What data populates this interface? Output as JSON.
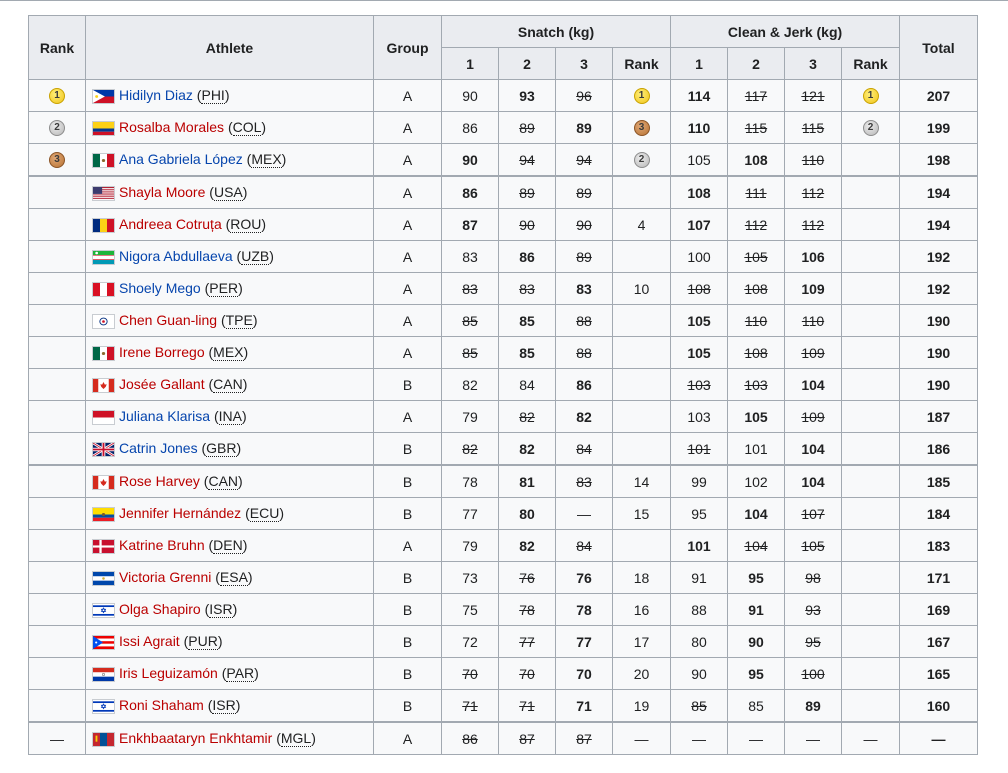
{
  "headers": {
    "rank": "Rank",
    "athlete": "Athlete",
    "group": "Group",
    "snatch": "Snatch (kg)",
    "clean_jerk": "Clean & Jerk (kg)",
    "total": "Total",
    "sub": [
      "1",
      "2",
      "3",
      "Rank",
      "1",
      "2",
      "3",
      "Rank"
    ]
  },
  "rows": [
    {
      "rank": "1",
      "rank_type": "gold",
      "name": "Hidilyn Diaz",
      "code": "PHI",
      "flag": "PHI",
      "link": "blue",
      "group": "A",
      "sn": [
        {
          "v": "90",
          "s": "n"
        },
        {
          "v": "93",
          "s": "b"
        },
        {
          "v": "96",
          "s": "x"
        }
      ],
      "sn_rank": "1",
      "sn_rank_type": "gold",
      "cj": [
        {
          "v": "114",
          "s": "b"
        },
        {
          "v": "117",
          "s": "x"
        },
        {
          "v": "121",
          "s": "x"
        }
      ],
      "cj_rank": "1",
      "cj_rank_type": "gold",
      "total": "207"
    },
    {
      "rank": "2",
      "rank_type": "silver",
      "name": "Rosalba Morales",
      "code": "COL",
      "flag": "COL",
      "link": "red",
      "group": "A",
      "sn": [
        {
          "v": "86",
          "s": "n"
        },
        {
          "v": "89",
          "s": "x"
        },
        {
          "v": "89",
          "s": "b"
        }
      ],
      "sn_rank": "3",
      "sn_rank_type": "bronze",
      "cj": [
        {
          "v": "110",
          "s": "b"
        },
        {
          "v": "115",
          "s": "x"
        },
        {
          "v": "115",
          "s": "x"
        }
      ],
      "cj_rank": "2",
      "cj_rank_type": "silver",
      "total": "199"
    },
    {
      "rank": "3",
      "rank_type": "bronze",
      "name": "Ana Gabriela López",
      "code": "MEX",
      "flag": "MEX",
      "link": "blue",
      "group": "A",
      "sn": [
        {
          "v": "90",
          "s": "b"
        },
        {
          "v": "94",
          "s": "x"
        },
        {
          "v": "94",
          "s": "x"
        }
      ],
      "sn_rank": "2",
      "sn_rank_type": "silver",
      "cj": [
        {
          "v": "105",
          "s": "n"
        },
        {
          "v": "108",
          "s": "b"
        },
        {
          "v": "110",
          "s": "x"
        }
      ],
      "cj_rank": "",
      "cj_rank_type": "none",
      "total": "198"
    },
    {
      "rank": "",
      "rank_type": "none",
      "name": "Shayla Moore",
      "code": "USA",
      "flag": "USA",
      "link": "red",
      "group": "A",
      "sep": true,
      "sn": [
        {
          "v": "86",
          "s": "b"
        },
        {
          "v": "89",
          "s": "x"
        },
        {
          "v": "89",
          "s": "x"
        }
      ],
      "sn_rank": "",
      "sn_rank_type": "none",
      "cj": [
        {
          "v": "108",
          "s": "b"
        },
        {
          "v": "111",
          "s": "x"
        },
        {
          "v": "112",
          "s": "x"
        }
      ],
      "cj_rank": "",
      "cj_rank_type": "none",
      "total": "194"
    },
    {
      "rank": "",
      "rank_type": "none",
      "name": "Andreea Cotruța",
      "code": "ROU",
      "flag": "ROU",
      "link": "red",
      "group": "A",
      "sn": [
        {
          "v": "87",
          "s": "b"
        },
        {
          "v": "90",
          "s": "x"
        },
        {
          "v": "90",
          "s": "x"
        }
      ],
      "sn_rank": "4",
      "sn_rank_type": "none",
      "cj": [
        {
          "v": "107",
          "s": "b"
        },
        {
          "v": "112",
          "s": "x"
        },
        {
          "v": "112",
          "s": "x"
        }
      ],
      "cj_rank": "",
      "cj_rank_type": "none",
      "total": "194"
    },
    {
      "rank": "",
      "rank_type": "none",
      "name": "Nigora Abdullaeva",
      "code": "UZB",
      "flag": "UZB",
      "link": "blue",
      "group": "A",
      "sn": [
        {
          "v": "83",
          "s": "n"
        },
        {
          "v": "86",
          "s": "b"
        },
        {
          "v": "89",
          "s": "x"
        }
      ],
      "sn_rank": "",
      "sn_rank_type": "none",
      "cj": [
        {
          "v": "100",
          "s": "n"
        },
        {
          "v": "105",
          "s": "x"
        },
        {
          "v": "106",
          "s": "b"
        }
      ],
      "cj_rank": "",
      "cj_rank_type": "none",
      "total": "192"
    },
    {
      "rank": "",
      "rank_type": "none",
      "name": "Shoely Mego",
      "code": "PER",
      "flag": "PER",
      "link": "blue",
      "group": "A",
      "sn": [
        {
          "v": "83",
          "s": "x"
        },
        {
          "v": "83",
          "s": "x"
        },
        {
          "v": "83",
          "s": "b"
        }
      ],
      "sn_rank": "10",
      "sn_rank_type": "none",
      "cj": [
        {
          "v": "108",
          "s": "x"
        },
        {
          "v": "108",
          "s": "x"
        },
        {
          "v": "109",
          "s": "b"
        }
      ],
      "cj_rank": "",
      "cj_rank_type": "none",
      "total": "192"
    },
    {
      "rank": "",
      "rank_type": "none",
      "name": "Chen Guan-ling",
      "code": "TPE",
      "flag": "TPE",
      "link": "red",
      "group": "A",
      "sn": [
        {
          "v": "85",
          "s": "x"
        },
        {
          "v": "85",
          "s": "b"
        },
        {
          "v": "88",
          "s": "x"
        }
      ],
      "sn_rank": "",
      "sn_rank_type": "none",
      "cj": [
        {
          "v": "105",
          "s": "b"
        },
        {
          "v": "110",
          "s": "x"
        },
        {
          "v": "110",
          "s": "x"
        }
      ],
      "cj_rank": "",
      "cj_rank_type": "none",
      "total": "190"
    },
    {
      "rank": "",
      "rank_type": "none",
      "name": "Irene Borrego",
      "code": "MEX",
      "flag": "MEX",
      "link": "red",
      "group": "A",
      "sn": [
        {
          "v": "85",
          "s": "x"
        },
        {
          "v": "85",
          "s": "b"
        },
        {
          "v": "88",
          "s": "x"
        }
      ],
      "sn_rank": "",
      "sn_rank_type": "none",
      "cj": [
        {
          "v": "105",
          "s": "b"
        },
        {
          "v": "108",
          "s": "x"
        },
        {
          "v": "109",
          "s": "x"
        }
      ],
      "cj_rank": "",
      "cj_rank_type": "none",
      "total": "190"
    },
    {
      "rank": "",
      "rank_type": "none",
      "name": "Josée Gallant",
      "code": "CAN",
      "flag": "CAN",
      "link": "red",
      "group": "B",
      "sn": [
        {
          "v": "82",
          "s": "n"
        },
        {
          "v": "84",
          "s": "n"
        },
        {
          "v": "86",
          "s": "b"
        }
      ],
      "sn_rank": "",
      "sn_rank_type": "none",
      "cj": [
        {
          "v": "103",
          "s": "x"
        },
        {
          "v": "103",
          "s": "x"
        },
        {
          "v": "104",
          "s": "b"
        }
      ],
      "cj_rank": "",
      "cj_rank_type": "none",
      "total": "190"
    },
    {
      "rank": "",
      "rank_type": "none",
      "name": "Juliana Klarisa",
      "code": "INA",
      "flag": "INA",
      "link": "blue",
      "group": "A",
      "sn": [
        {
          "v": "79",
          "s": "n"
        },
        {
          "v": "82",
          "s": "x"
        },
        {
          "v": "82",
          "s": "b"
        }
      ],
      "sn_rank": "",
      "sn_rank_type": "none",
      "cj": [
        {
          "v": "103",
          "s": "n"
        },
        {
          "v": "105",
          "s": "b"
        },
        {
          "v": "109",
          "s": "x"
        }
      ],
      "cj_rank": "",
      "cj_rank_type": "none",
      "total": "187"
    },
    {
      "rank": "",
      "rank_type": "none",
      "name": "Catrin Jones",
      "code": "GBR",
      "flag": "GBR",
      "link": "blue",
      "group": "B",
      "sn": [
        {
          "v": "82",
          "s": "x"
        },
        {
          "v": "82",
          "s": "b"
        },
        {
          "v": "84",
          "s": "x"
        }
      ],
      "sn_rank": "",
      "sn_rank_type": "none",
      "cj": [
        {
          "v": "101",
          "s": "x"
        },
        {
          "v": "101",
          "s": "n"
        },
        {
          "v": "104",
          "s": "b"
        }
      ],
      "cj_rank": "",
      "cj_rank_type": "none",
      "total": "186"
    },
    {
      "rank": "",
      "rank_type": "none",
      "name": "Rose Harvey",
      "code": "CAN",
      "flag": "CAN",
      "link": "red",
      "group": "B",
      "sep": true,
      "sn": [
        {
          "v": "78",
          "s": "n"
        },
        {
          "v": "81",
          "s": "b"
        },
        {
          "v": "83",
          "s": "x"
        }
      ],
      "sn_rank": "14",
      "sn_rank_type": "none",
      "cj": [
        {
          "v": "99",
          "s": "n"
        },
        {
          "v": "102",
          "s": "n"
        },
        {
          "v": "104",
          "s": "b"
        }
      ],
      "cj_rank": "",
      "cj_rank_type": "none",
      "total": "185"
    },
    {
      "rank": "",
      "rank_type": "none",
      "name": "Jennifer Hernández",
      "code": "ECU",
      "flag": "ECU",
      "link": "red",
      "group": "B",
      "sn": [
        {
          "v": "77",
          "s": "n"
        },
        {
          "v": "80",
          "s": "b"
        },
        {
          "v": "—",
          "s": "n"
        }
      ],
      "sn_rank": "15",
      "sn_rank_type": "none",
      "cj": [
        {
          "v": "95",
          "s": "n"
        },
        {
          "v": "104",
          "s": "b"
        },
        {
          "v": "107",
          "s": "x"
        }
      ],
      "cj_rank": "",
      "cj_rank_type": "none",
      "total": "184"
    },
    {
      "rank": "",
      "rank_type": "none",
      "name": "Katrine Bruhn",
      "code": "DEN",
      "flag": "DEN",
      "link": "red",
      "group": "A",
      "sn": [
        {
          "v": "79",
          "s": "n"
        },
        {
          "v": "82",
          "s": "b"
        },
        {
          "v": "84",
          "s": "x"
        }
      ],
      "sn_rank": "",
      "sn_rank_type": "none",
      "cj": [
        {
          "v": "101",
          "s": "b"
        },
        {
          "v": "104",
          "s": "x"
        },
        {
          "v": "105",
          "s": "x"
        }
      ],
      "cj_rank": "",
      "cj_rank_type": "none",
      "total": "183"
    },
    {
      "rank": "",
      "rank_type": "none",
      "name": "Victoria Grenni",
      "code": "ESA",
      "flag": "ESA",
      "link": "red",
      "group": "B",
      "sn": [
        {
          "v": "73",
          "s": "n"
        },
        {
          "v": "76",
          "s": "x"
        },
        {
          "v": "76",
          "s": "b"
        }
      ],
      "sn_rank": "18",
      "sn_rank_type": "none",
      "cj": [
        {
          "v": "91",
          "s": "n"
        },
        {
          "v": "95",
          "s": "b"
        },
        {
          "v": "98",
          "s": "x"
        }
      ],
      "cj_rank": "",
      "cj_rank_type": "none",
      "total": "171"
    },
    {
      "rank": "",
      "rank_type": "none",
      "name": "Olga Shapiro",
      "code": "ISR",
      "flag": "ISR",
      "link": "red",
      "group": "B",
      "sn": [
        {
          "v": "75",
          "s": "n"
        },
        {
          "v": "78",
          "s": "x"
        },
        {
          "v": "78",
          "s": "b"
        }
      ],
      "sn_rank": "16",
      "sn_rank_type": "none",
      "cj": [
        {
          "v": "88",
          "s": "n"
        },
        {
          "v": "91",
          "s": "b"
        },
        {
          "v": "93",
          "s": "x"
        }
      ],
      "cj_rank": "",
      "cj_rank_type": "none",
      "total": "169"
    },
    {
      "rank": "",
      "rank_type": "none",
      "name": "Issi Agrait",
      "code": "PUR",
      "flag": "PUR",
      "link": "red",
      "group": "B",
      "sn": [
        {
          "v": "72",
          "s": "n"
        },
        {
          "v": "77",
          "s": "x"
        },
        {
          "v": "77",
          "s": "b"
        }
      ],
      "sn_rank": "17",
      "sn_rank_type": "none",
      "cj": [
        {
          "v": "80",
          "s": "n"
        },
        {
          "v": "90",
          "s": "b"
        },
        {
          "v": "95",
          "s": "x"
        }
      ],
      "cj_rank": "",
      "cj_rank_type": "none",
      "total": "167"
    },
    {
      "rank": "",
      "rank_type": "none",
      "name": "Iris Leguizamón",
      "code": "PAR",
      "flag": "PAR",
      "link": "red",
      "group": "B",
      "sn": [
        {
          "v": "70",
          "s": "x"
        },
        {
          "v": "70",
          "s": "x"
        },
        {
          "v": "70",
          "s": "b"
        }
      ],
      "sn_rank": "20",
      "sn_rank_type": "none",
      "cj": [
        {
          "v": "90",
          "s": "n"
        },
        {
          "v": "95",
          "s": "b"
        },
        {
          "v": "100",
          "s": "x"
        }
      ],
      "cj_rank": "",
      "cj_rank_type": "none",
      "total": "165"
    },
    {
      "rank": "",
      "rank_type": "none",
      "name": "Roni Shaham",
      "code": "ISR",
      "flag": "ISR",
      "link": "red",
      "group": "B",
      "sn": [
        {
          "v": "71",
          "s": "x"
        },
        {
          "v": "71",
          "s": "x"
        },
        {
          "v": "71",
          "s": "b"
        }
      ],
      "sn_rank": "19",
      "sn_rank_type": "none",
      "cj": [
        {
          "v": "85",
          "s": "x"
        },
        {
          "v": "85",
          "s": "n"
        },
        {
          "v": "89",
          "s": "b"
        }
      ],
      "cj_rank": "",
      "cj_rank_type": "none",
      "total": "160"
    },
    {
      "rank": "—",
      "rank_type": "dash",
      "name": "Enkhbaataryn Enkhtamir",
      "code": "MGL",
      "flag": "MGL",
      "link": "red",
      "group": "A",
      "sep": true,
      "sn": [
        {
          "v": "86",
          "s": "x"
        },
        {
          "v": "87",
          "s": "x"
        },
        {
          "v": "87",
          "s": "x"
        }
      ],
      "sn_rank": "—",
      "sn_rank_type": "none",
      "cj": [
        {
          "v": "—",
          "s": "n"
        },
        {
          "v": "—",
          "s": "n"
        },
        {
          "v": "—",
          "s": "n"
        }
      ],
      "cj_rank": "—",
      "cj_rank_type": "none",
      "total": "—"
    }
  ]
}
